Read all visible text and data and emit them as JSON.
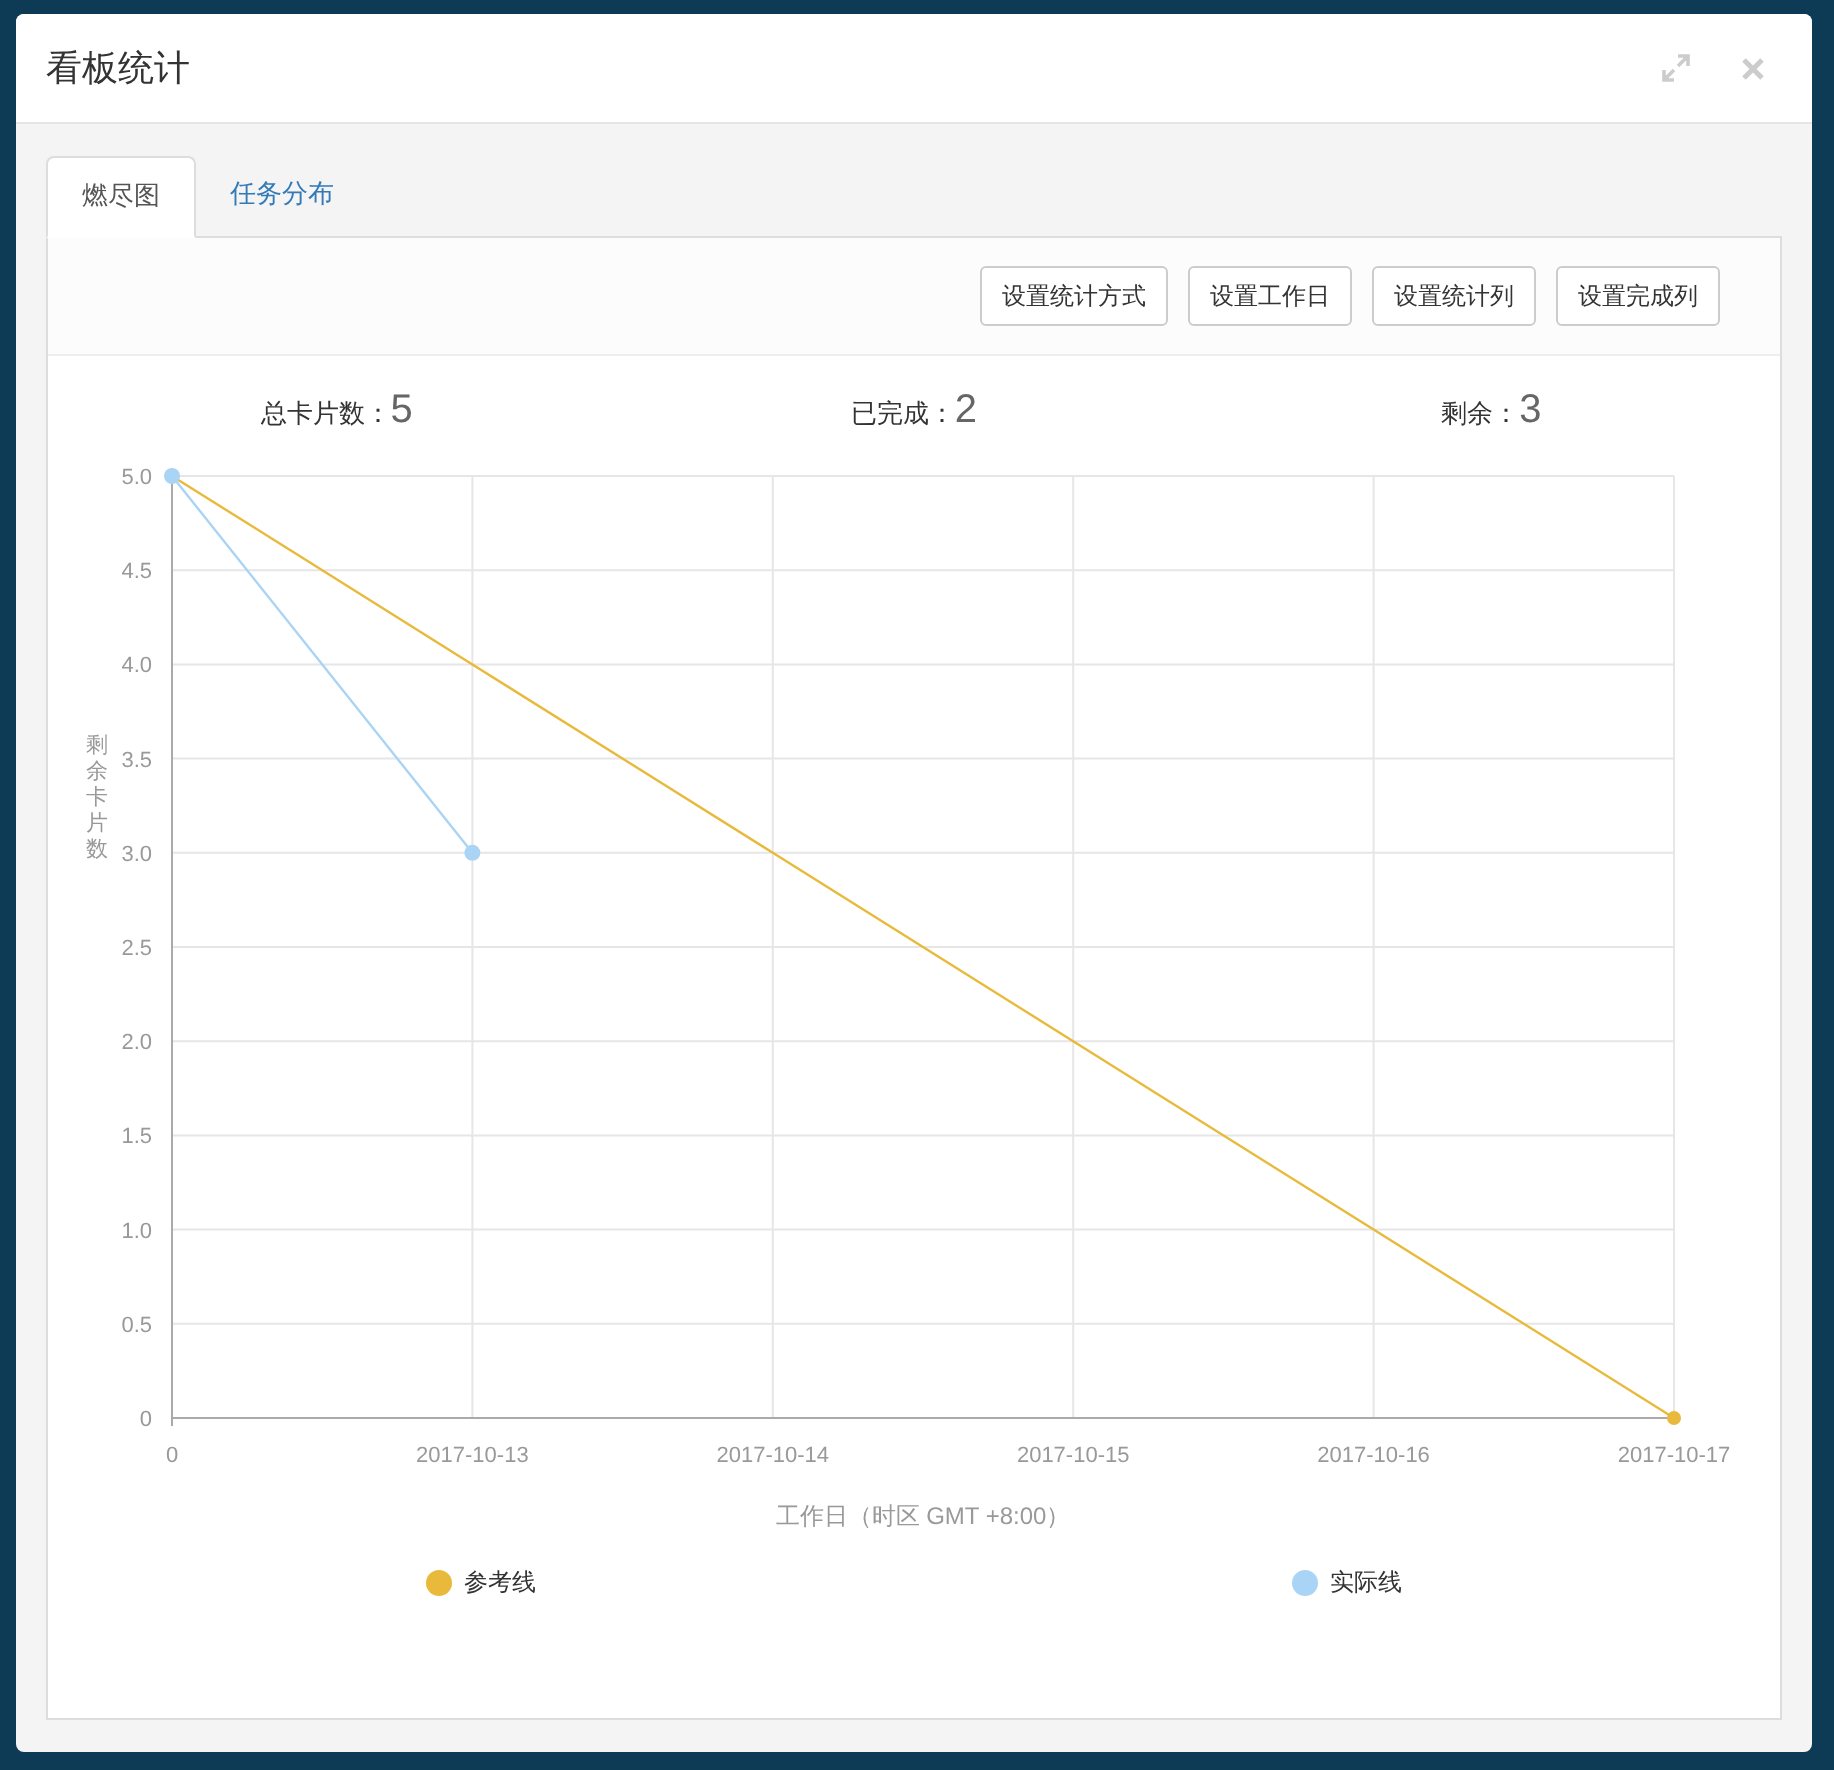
{
  "dialog": {
    "title": "看板统计"
  },
  "tabs": [
    {
      "label": "燃尽图",
      "selected": true
    },
    {
      "label": "任务分布",
      "selected": false
    }
  ],
  "toolbar": {
    "buttons": [
      "设置统计方式",
      "设置工作日",
      "设置统计列",
      "设置完成列"
    ]
  },
  "stats": [
    {
      "label": "总卡片数：",
      "value": "5"
    },
    {
      "label": "已完成：",
      "value": "2"
    },
    {
      "label": "剩余：",
      "value": "3"
    }
  ],
  "chart": {
    "chart_data": {
      "type": "line",
      "xlabel": "工作日（时区 GMT +8:00）",
      "ylabel": "剩余卡片数",
      "categories": [
        "0",
        "2017-10-13",
        "2017-10-14",
        "2017-10-15",
        "2017-10-16",
        "2017-10-17"
      ],
      "ylim": [
        0,
        5
      ],
      "yticks": [
        {
          "value": 0,
          "label": "0"
        },
        {
          "value": 0.5,
          "label": "0.5"
        },
        {
          "value": 1,
          "label": "1.0"
        },
        {
          "value": 1.5,
          "label": "1.5"
        },
        {
          "value": 2,
          "label": "2.0"
        },
        {
          "value": 2.5,
          "label": "2.5"
        },
        {
          "value": 3,
          "label": "3.0"
        },
        {
          "value": 3.5,
          "label": "3.5"
        },
        {
          "value": 4,
          "label": "4.0"
        },
        {
          "value": 4.5,
          "label": "4.5"
        },
        {
          "value": 5,
          "label": "5.0"
        }
      ],
      "series": [
        {
          "name": "参考线",
          "color": "#e8b93a",
          "marker": true,
          "values": [
            5,
            4,
            3,
            2,
            1,
            0
          ]
        },
        {
          "name": "实际线",
          "color": "#a9d4f5",
          "marker": true,
          "values": [
            5,
            3,
            null,
            null,
            null,
            null
          ]
        }
      ],
      "grid": true
    }
  }
}
